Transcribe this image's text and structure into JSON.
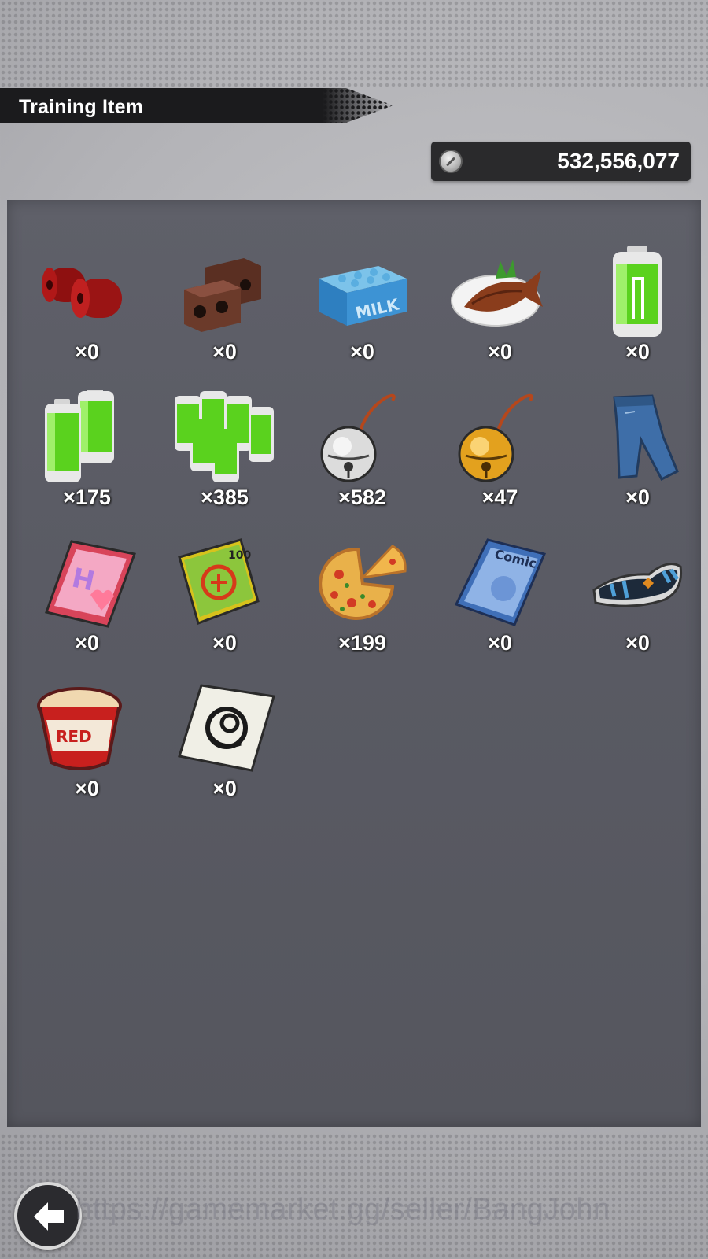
{
  "header": {
    "title": "Training Item"
  },
  "currency": {
    "icon": "zeni-coin-icon",
    "value": "532,556,077"
  },
  "items": [
    {
      "name": "red-weights-icon",
      "count": "×0"
    },
    {
      "name": "brick-weights-icon",
      "count": "×0"
    },
    {
      "name": "milk-crate-icon",
      "count": "×0"
    },
    {
      "name": "grilled-fish-icon",
      "count": "×0"
    },
    {
      "name": "energy-battery-icon",
      "count": "×0"
    },
    {
      "name": "energy-battery-pair-icon",
      "count": "×175"
    },
    {
      "name": "energy-battery-pack-icon",
      "count": "×385"
    },
    {
      "name": "silver-bell-icon",
      "count": "×582"
    },
    {
      "name": "gold-bell-icon",
      "count": "×47"
    },
    {
      "name": "jeans-icon",
      "count": "×0"
    },
    {
      "name": "romance-book-icon",
      "count": "×0"
    },
    {
      "name": "joke-book-icon",
      "count": "×0"
    },
    {
      "name": "pizza-icon",
      "count": "×199"
    },
    {
      "name": "comic-book-icon",
      "count": "×0"
    },
    {
      "name": "slipper-icon",
      "count": "×0"
    },
    {
      "name": "cup-noodle-icon",
      "count": "×0"
    },
    {
      "name": "capsule-card-icon",
      "count": "×0"
    }
  ],
  "footer": {
    "back_icon": "back-arrow-icon",
    "watermark": "https://gamemarket.gg/seller/BangJohn"
  }
}
